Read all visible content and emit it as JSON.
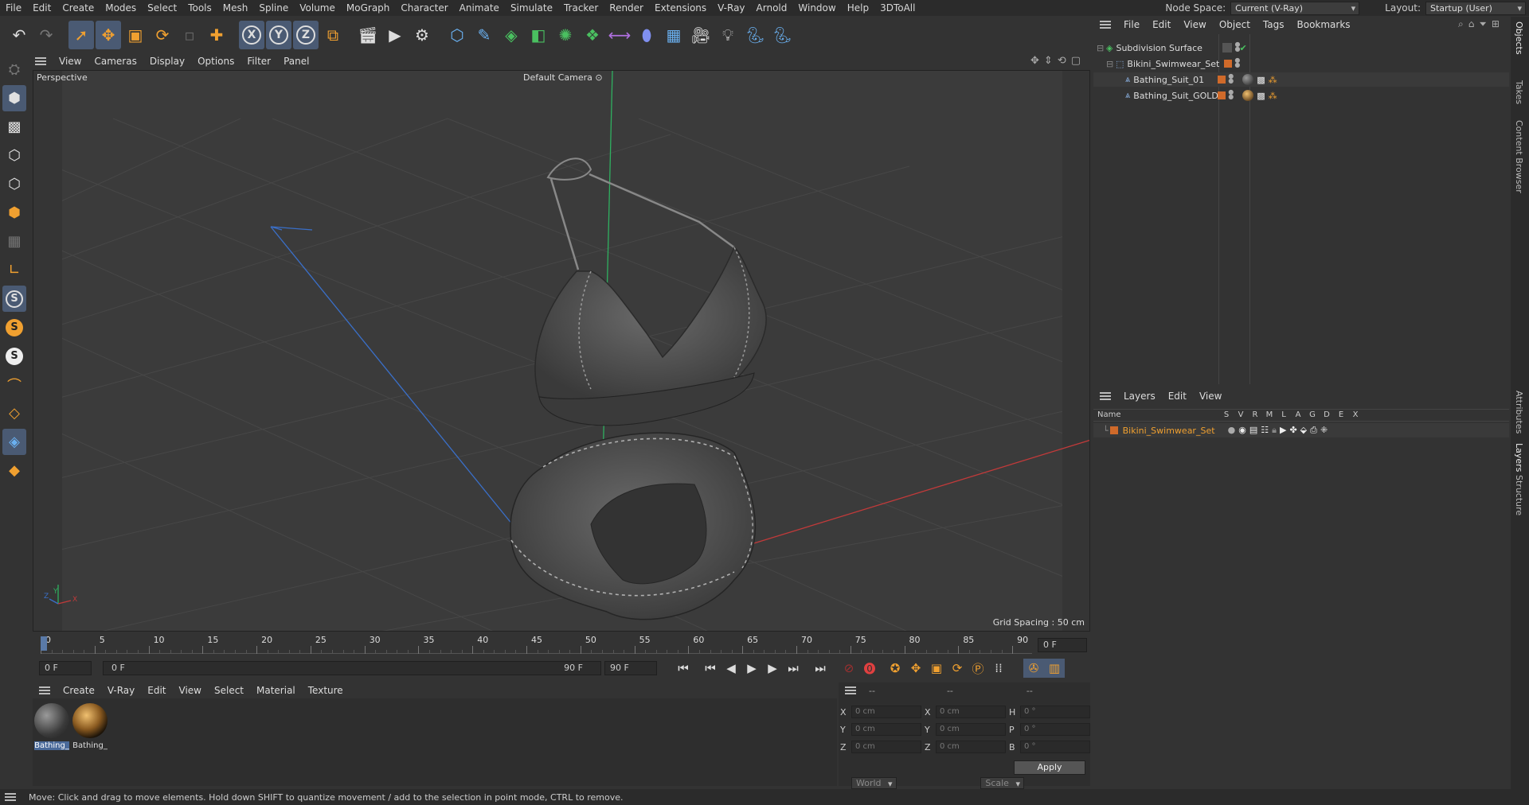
{
  "menubar": {
    "items": [
      "File",
      "Edit",
      "Create",
      "Modes",
      "Select",
      "Tools",
      "Mesh",
      "Spline",
      "Volume",
      "MoGraph",
      "Character",
      "Animate",
      "Simulate",
      "Tracker",
      "Render",
      "Extensions",
      "V-Ray",
      "Arnold",
      "Window",
      "Help",
      "3DToAll"
    ],
    "node_space_label": "Node Space:",
    "node_space_value": "Current (V-Ray)",
    "layout_label": "Layout:",
    "layout_value": "Startup (User)"
  },
  "viewport": {
    "menu": [
      "View",
      "Cameras",
      "Display",
      "Options",
      "Filter",
      "Panel"
    ],
    "label": "Perspective",
    "camera": "Default Camera",
    "camera_icon": "camera-icon",
    "grid_spacing": "Grid Spacing : 50 cm",
    "axis_x": "X",
    "axis_y": "Y",
    "axis_z": "Z"
  },
  "timeline": {
    "ticks": [
      "0",
      "5",
      "10",
      "15",
      "20",
      "25",
      "30",
      "35",
      "40",
      "45",
      "50",
      "55",
      "60",
      "65",
      "70",
      "75",
      "80",
      "85",
      "90"
    ],
    "current_frame": "0 F",
    "start_field": "0 F",
    "range_start": "0 F",
    "range_end": "90 F",
    "end_field": "90 F"
  },
  "material_panel": {
    "menu": [
      "Create",
      "V-Ray",
      "Edit",
      "View",
      "Select",
      "Material",
      "Texture"
    ],
    "materials": [
      {
        "label": "Bathing_"
      },
      {
        "label": "Bathing_"
      }
    ]
  },
  "coords": {
    "headers": [
      "--",
      "--",
      "--"
    ],
    "rows": [
      {
        "a": "X",
        "av": "0 cm",
        "b": "X",
        "bv": "0 cm",
        "c": "H",
        "cv": "0 °"
      },
      {
        "a": "Y",
        "av": "0 cm",
        "b": "Y",
        "bv": "0 cm",
        "c": "P",
        "cv": "0 °"
      },
      {
        "a": "Z",
        "av": "0 cm",
        "b": "Z",
        "bv": "0 cm",
        "c": "B",
        "cv": "0 °"
      }
    ],
    "mode1": "World",
    "mode2": "Scale",
    "apply": "Apply"
  },
  "objects": {
    "menu": [
      "File",
      "Edit",
      "View",
      "Object",
      "Tags",
      "Bookmarks"
    ],
    "items": [
      {
        "name": "Subdivision Surface"
      },
      {
        "name": "Bikini_Swimwear_Set"
      },
      {
        "name": "Bathing_Suit_01"
      },
      {
        "name": "Bathing_Suit_GOLD"
      }
    ]
  },
  "layers": {
    "menu": [
      "Layers",
      "Edit",
      "View"
    ],
    "name_header": "Name",
    "columns": [
      "S",
      "V",
      "R",
      "M",
      "L",
      "A",
      "G",
      "D",
      "E",
      "X"
    ],
    "items": [
      {
        "name": "Bikini_Swimwear_Set"
      }
    ]
  },
  "side_tabs": [
    "Objects",
    "Takes",
    "Content Browser",
    "Attributes",
    "Layers",
    "Structure"
  ],
  "status": "Move: Click and drag to move elements. Hold down SHIFT to quantize movement / add to the selection in point mode, CTRL to remove."
}
